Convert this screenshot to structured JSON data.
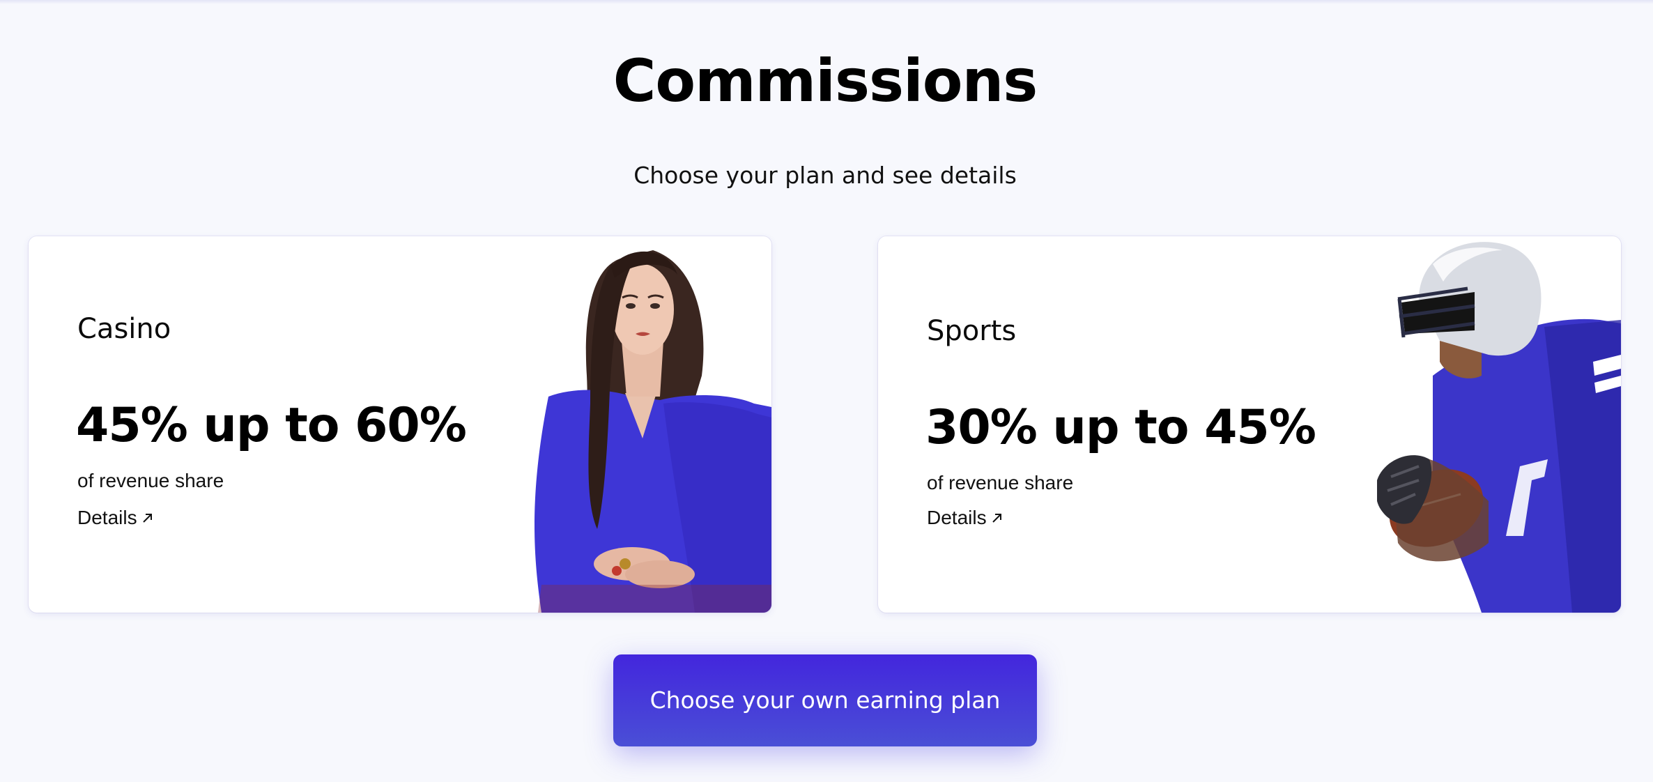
{
  "header": {
    "title": "Commissions",
    "subtitle": "Choose your plan and see details"
  },
  "plans": [
    {
      "name": "Casino",
      "rate": "45% up to 60%",
      "description": "of revenue share",
      "link_label": "Details",
      "link_icon": "arrow-up-right-icon",
      "illustration": "casino-dealer-woman-image"
    },
    {
      "name": "Sports",
      "rate": "30% up to 45%",
      "description": "of revenue share",
      "link_label": "Details",
      "link_icon": "arrow-up-right-icon",
      "illustration": "football-player-image"
    }
  ],
  "cta": {
    "label": "Choose your own earning plan"
  },
  "colors": {
    "background": "#f7f8fd",
    "card": "#ffffff",
    "accent": "#4326dd",
    "accent_end": "#4a4fd6",
    "jersey_blue": "#3b35c9"
  }
}
